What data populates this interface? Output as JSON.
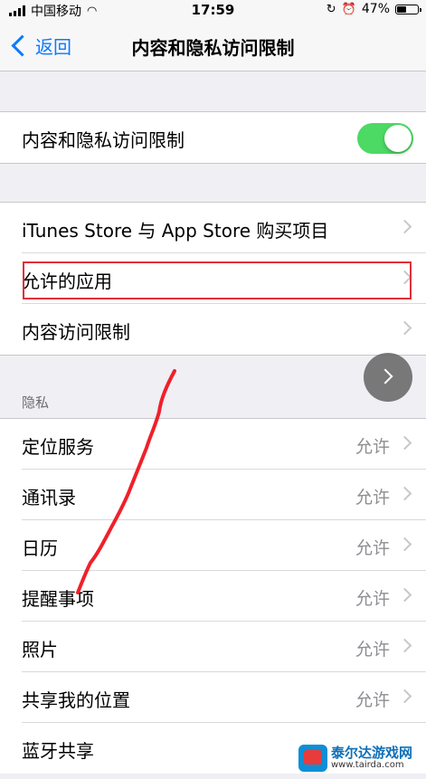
{
  "status_bar": {
    "carrier": "中国移动",
    "time": "17:59",
    "battery": "47%"
  },
  "nav": {
    "back_label": "返回",
    "title": "内容和隐私访问限制"
  },
  "toggle_row": {
    "label": "内容和隐私访问限制",
    "enabled": true
  },
  "store_group": [
    {
      "label": "iTunes Store 与 App Store 购买项目"
    },
    {
      "label": "允许的应用"
    },
    {
      "label": "内容访问限制"
    }
  ],
  "privacy_header": "隐私",
  "privacy_items": [
    {
      "label": "定位服务",
      "value": "允许"
    },
    {
      "label": "通讯录",
      "value": "允许"
    },
    {
      "label": "日历",
      "value": "允许"
    },
    {
      "label": "提醒事项",
      "value": "允许"
    },
    {
      "label": "照片",
      "value": "允许"
    },
    {
      "label": "共享我的位置",
      "value": "允许"
    },
    {
      "label": "蓝牙共享",
      "value": ""
    }
  ],
  "watermark": {
    "title": "泰尔达游戏网",
    "url": "www.tairda.com"
  },
  "colors": {
    "accent": "#0a7aff",
    "toggle_on": "#4cd964",
    "highlight": "#e0303a"
  }
}
